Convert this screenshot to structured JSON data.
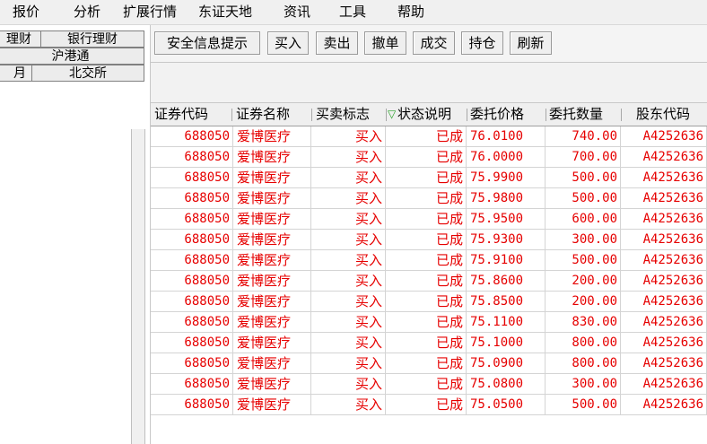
{
  "menu": [
    "报价",
    "分析",
    "扩展行情",
    "东证天地",
    "资讯",
    "工具",
    "帮助"
  ],
  "left_tabs": {
    "row1": [
      "理财",
      "银行理财"
    ],
    "row2": [
      "沪港通"
    ],
    "row3": [
      "月",
      "北交所"
    ]
  },
  "toolbar": {
    "buttons": [
      "安全信息提示",
      "买入",
      "卖出",
      "撤单",
      "成交",
      "持仓",
      "刷新"
    ]
  },
  "table": {
    "sort_indicator": "▽",
    "columns": [
      "证券代码",
      "证券名称",
      "买卖标志",
      "状态说明",
      "委托价格",
      "委托数量",
      "股东代码"
    ],
    "text_color": "#e60000",
    "rows": [
      [
        "688050",
        "爱博医疗",
        "买入",
        "已成",
        "76.0100",
        "740.00",
        "A4252636"
      ],
      [
        "688050",
        "爱博医疗",
        "买入",
        "已成",
        "76.0000",
        "700.00",
        "A4252636"
      ],
      [
        "688050",
        "爱博医疗",
        "买入",
        "已成",
        "75.9900",
        "500.00",
        "A4252636"
      ],
      [
        "688050",
        "爱博医疗",
        "买入",
        "已成",
        "75.9800",
        "500.00",
        "A4252636"
      ],
      [
        "688050",
        "爱博医疗",
        "买入",
        "已成",
        "75.9500",
        "600.00",
        "A4252636"
      ],
      [
        "688050",
        "爱博医疗",
        "买入",
        "已成",
        "75.9300",
        "300.00",
        "A4252636"
      ],
      [
        "688050",
        "爱博医疗",
        "买入",
        "已成",
        "75.9100",
        "500.00",
        "A4252636"
      ],
      [
        "688050",
        "爱博医疗",
        "买入",
        "已成",
        "75.8600",
        "200.00",
        "A4252636"
      ],
      [
        "688050",
        "爱博医疗",
        "买入",
        "已成",
        "75.8500",
        "200.00",
        "A4252636"
      ],
      [
        "688050",
        "爱博医疗",
        "买入",
        "已成",
        "75.1100",
        "830.00",
        "A4252636"
      ],
      [
        "688050",
        "爱博医疗",
        "买入",
        "已成",
        "75.1000",
        "800.00",
        "A4252636"
      ],
      [
        "688050",
        "爱博医疗",
        "买入",
        "已成",
        "75.0900",
        "800.00",
        "A4252636"
      ],
      [
        "688050",
        "爱博医疗",
        "买入",
        "已成",
        "75.0800",
        "300.00",
        "A4252636"
      ],
      [
        "688050",
        "爱博医疗",
        "买入",
        "已成",
        "75.0500",
        "500.00",
        "A4252636"
      ]
    ]
  }
}
